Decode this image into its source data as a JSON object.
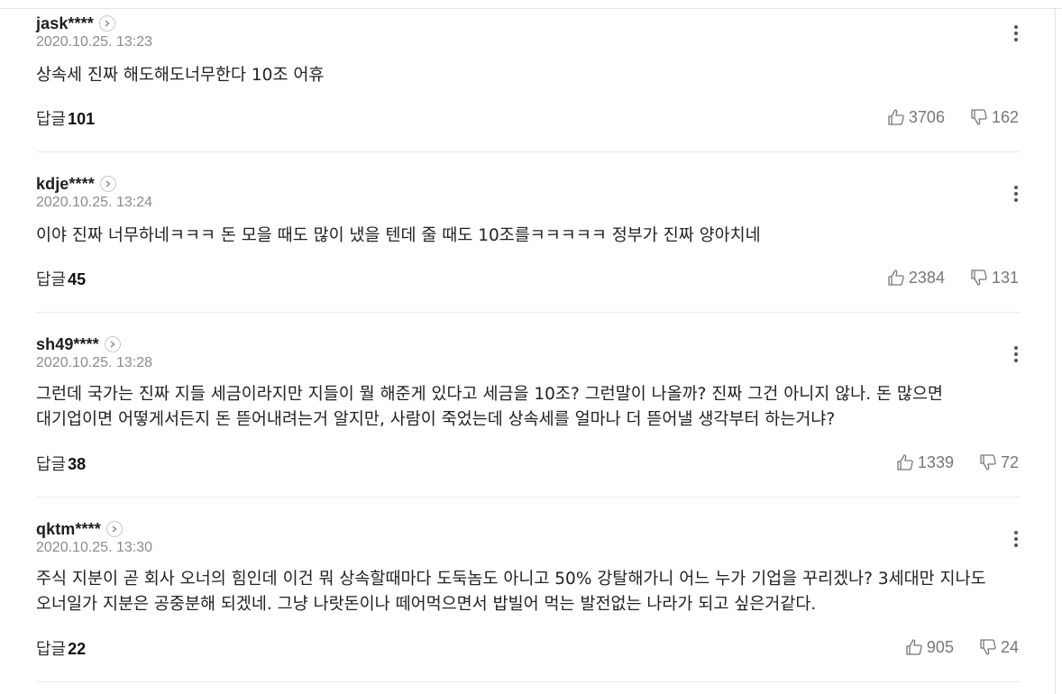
{
  "labels": {
    "reply": "답글"
  },
  "comments": [
    {
      "username": "jask****",
      "date": "2020.10.25. 13:23",
      "text": "상속세 진짜 해도해도너무한다 10조 어휴",
      "replies": "101",
      "likes": "3706",
      "dislikes": "162"
    },
    {
      "username": "kdje****",
      "date": "2020.10.25. 13:24",
      "text": "이야 진짜 너무하네ㅋㅋㅋ 돈 모을 때도 많이 냈을 텐데 줄 때도 10조를ㅋㅋㅋㅋㅋ 정부가 진짜 양아치네",
      "replies": "45",
      "likes": "2384",
      "dislikes": "131"
    },
    {
      "username": "sh49****",
      "date": "2020.10.25. 13:28",
      "text": "그런데 국가는 진짜 지들 세금이라지만 지들이 뭘 해준게 있다고 세금을 10조? 그런말이 나올까? 진짜 그건 아니지 않나. 돈 많으면 대기업이면 어떻게서든지 돈 뜯어내려는거 알지만, 사람이 죽었는데 상속세를 얼마나 더 뜯어낼 생각부터 하는거냐?",
      "replies": "38",
      "likes": "1339",
      "dislikes": "72"
    },
    {
      "username": "qktm****",
      "date": "2020.10.25. 13:30",
      "text": "주식 지분이 곧 회사 오너의 힘인데 이건 뭐 상속할때마다 도둑놈도 아니고 50% 강탈해가니 어느 누가 기업을 꾸리겠나? 3세대만 지나도 오너일가 지분은 공중분해 되겠네. 그냥 나랏돈이나 떼어먹으면서 밥빌어 먹는 발전없는 나라가 되고 싶은거같다.",
      "replies": "22",
      "likes": "905",
      "dislikes": "24"
    }
  ]
}
